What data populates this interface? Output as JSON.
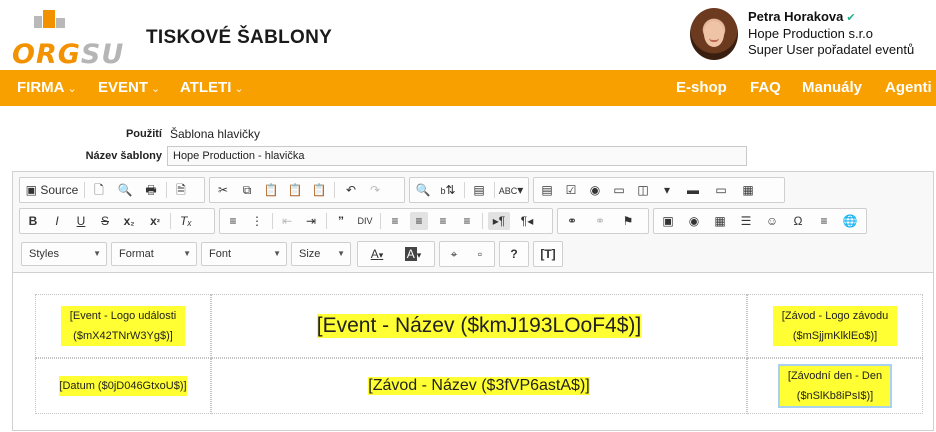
{
  "header": {
    "logo_text_1": "ORG",
    "logo_text_2": "SU",
    "title": "TISKOVÉ ŠABLONY",
    "user_name": "Petra Horakova",
    "user_company": "Hope Production s.r.o",
    "user_role": "Super User pořadatel eventů"
  },
  "nav": {
    "left": [
      {
        "label": "FIRMA"
      },
      {
        "label": "EVENT"
      },
      {
        "label": "ATLETI"
      }
    ],
    "right": [
      {
        "label": "E-shop"
      },
      {
        "label": "FAQ"
      },
      {
        "label": "Manuály"
      },
      {
        "label": "Agenti"
      }
    ]
  },
  "form": {
    "usage_label": "Použití",
    "usage_value": "Šablona hlavičky",
    "name_label": "Název šablony",
    "name_value": "Hope Production - hlavička"
  },
  "toolbar": {
    "source_label": "Source",
    "styles": "Styles",
    "format": "Format",
    "font": "Font",
    "size": "Size",
    "bold": "B",
    "italic": "I",
    "underline": "U",
    "strike": "S",
    "subscript_main": "x",
    "subscript_small": "₂",
    "superscript_main": "x",
    "superscript_small": "²",
    "help": "?",
    "text_color": "A",
    "bg_color": "A"
  },
  "content": {
    "event_logo": "[Event - Logo události ($mX42TNrW3Yg$)]",
    "event_name": "[Event - Název ($kmJ193LOoF4$)]",
    "race_logo": "[Závod - Logo závodu ($mSjjmKlklEo$)]",
    "date": "[Datum ($0jD046GtxoU$)]",
    "race_name": "[Závod - Název ($3fVP6astA$)]",
    "race_day": "[Závodní den - Den ($nSlKb8iPsI$)]"
  },
  "colors": {
    "brand_orange": "#f7a000",
    "highlight": "#ffff33",
    "check_green": "#1fb089"
  }
}
